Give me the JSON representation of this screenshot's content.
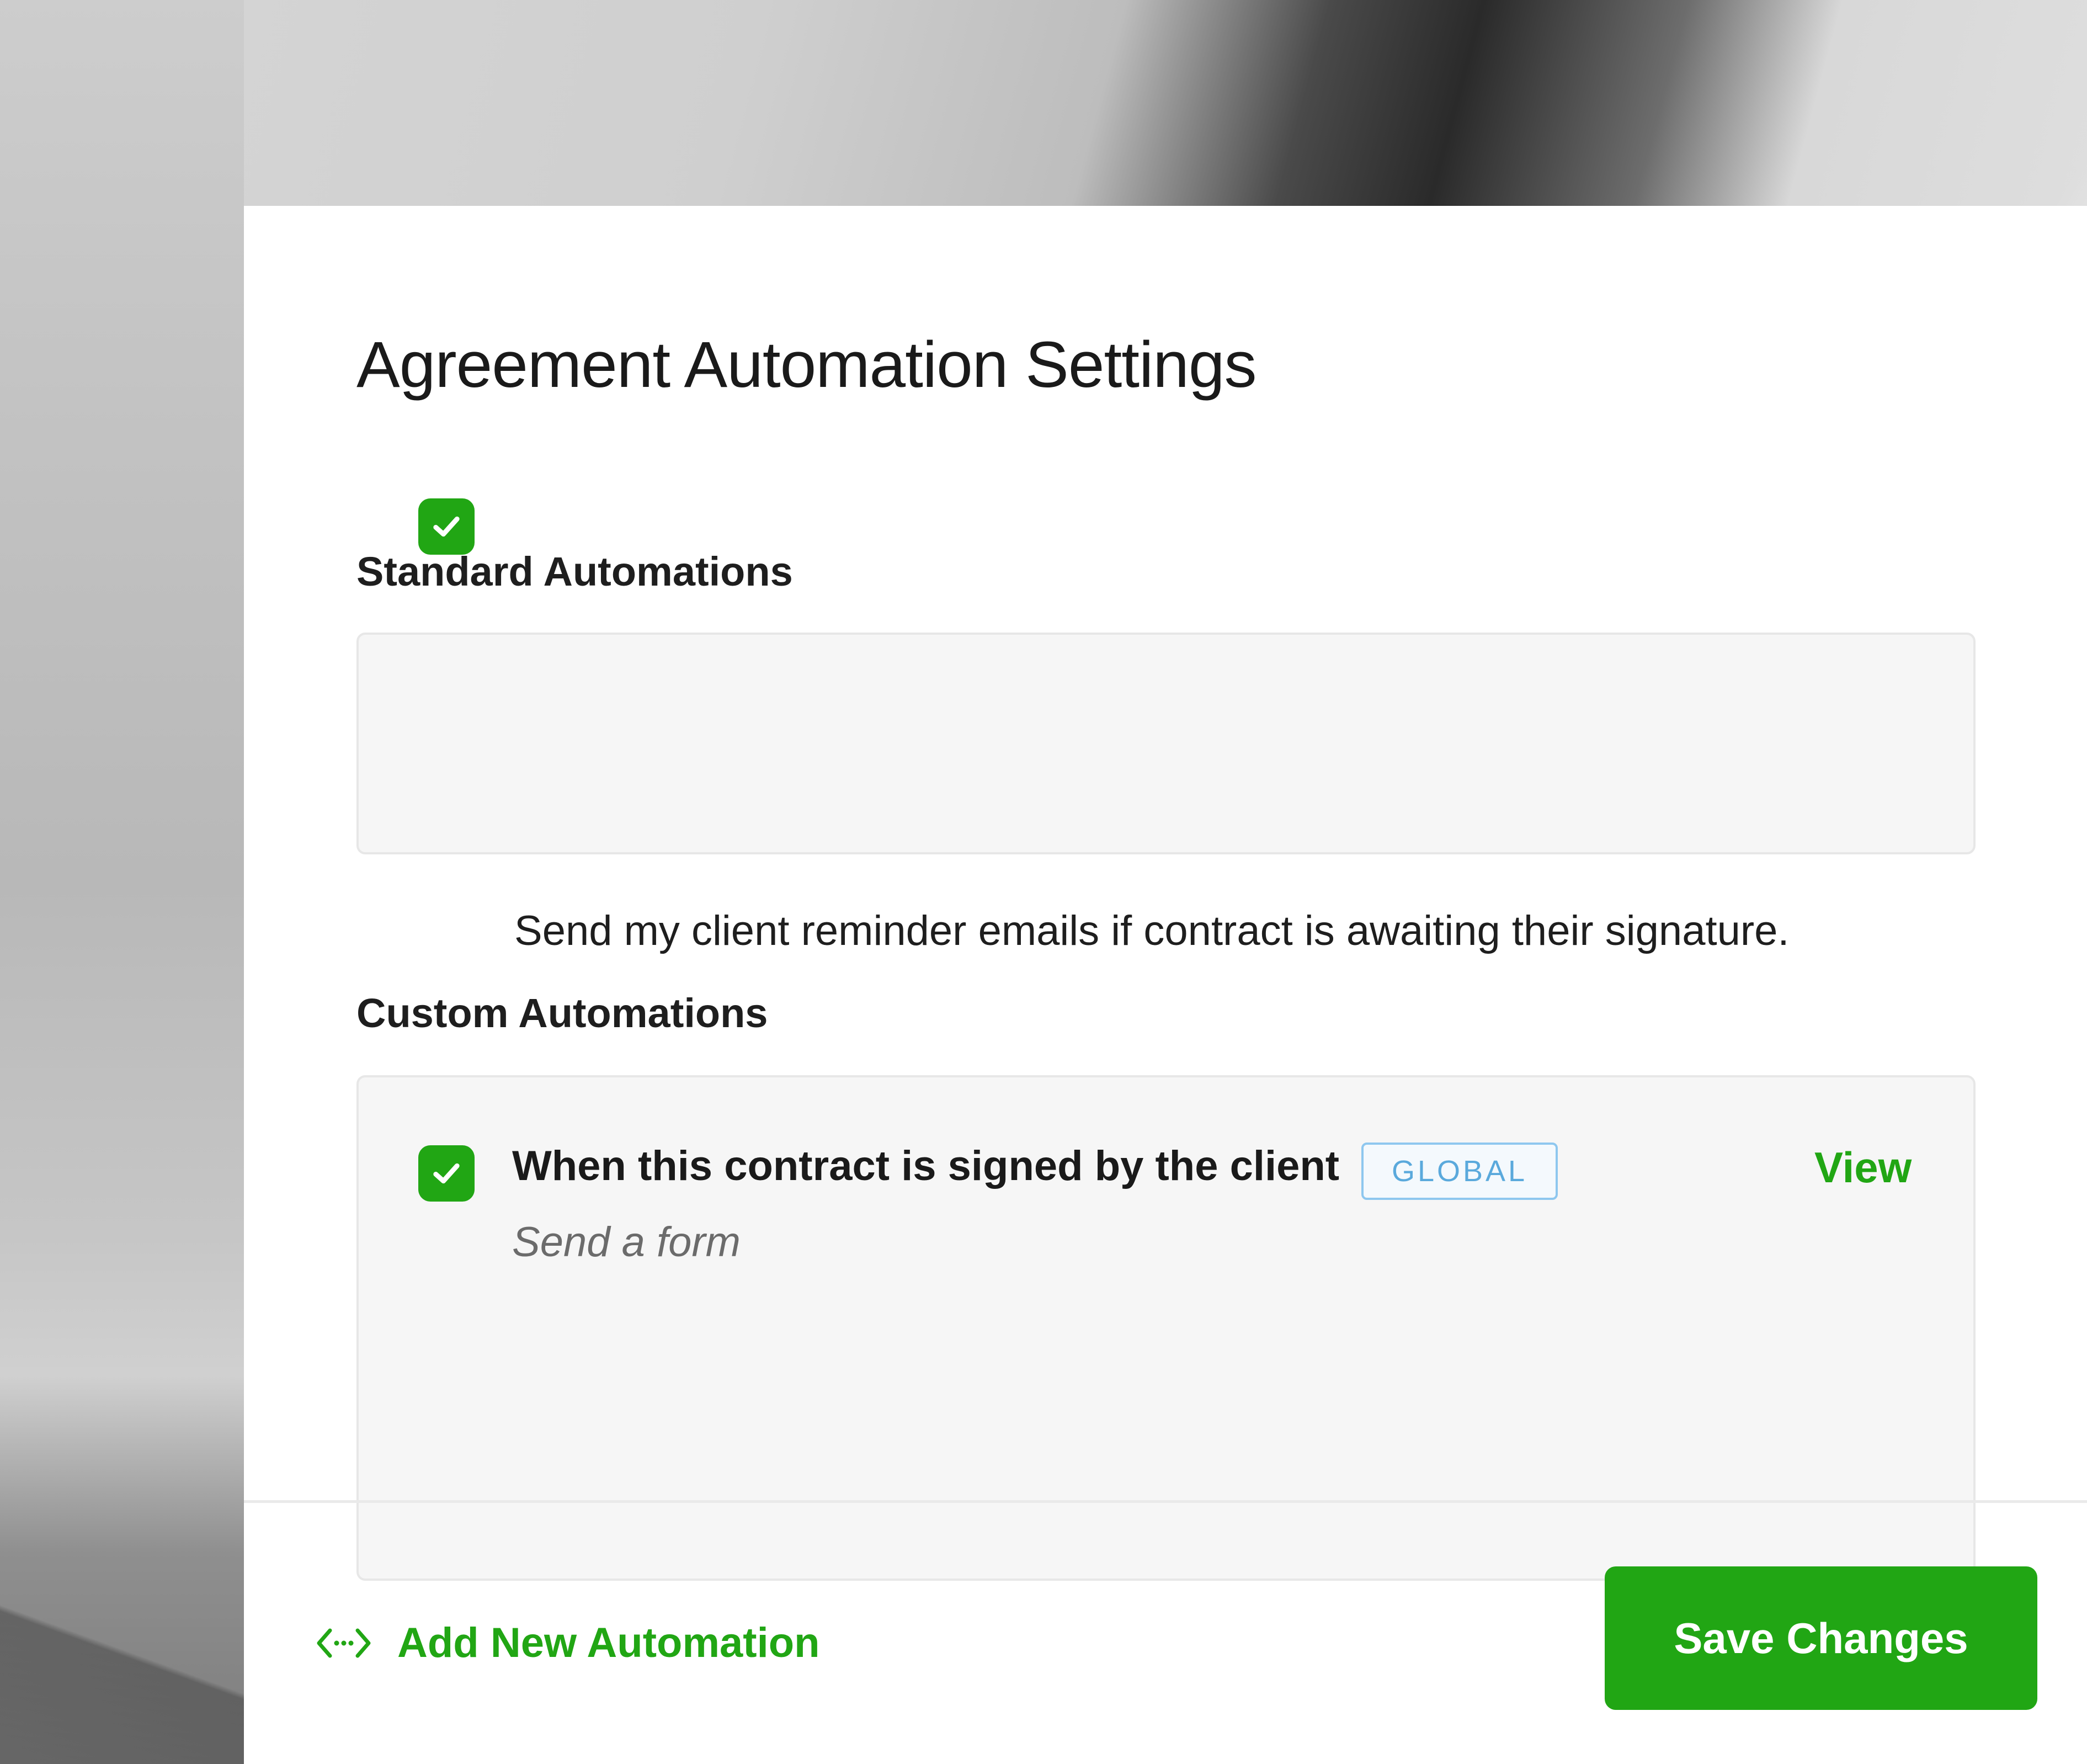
{
  "page_title": "Agreement Automation Settings",
  "standard": {
    "heading": "Standard Automations",
    "items": [
      {
        "checked": true,
        "label": "Send my client reminder emails if contract is awaiting their signature."
      }
    ]
  },
  "custom": {
    "heading": "Custom Automations",
    "items": [
      {
        "checked": true,
        "title": "When this contract is signed by the client",
        "badge": "GLOBAL",
        "action": "Send a form",
        "view_label": "View"
      }
    ]
  },
  "footer": {
    "add_label": "Add New Automation",
    "save_label": "Save Changes"
  },
  "colors": {
    "accent": "#21a614",
    "badge": "#5aa9dc"
  },
  "icons": {
    "checkbox": "check-icon",
    "add": "automation-icon"
  }
}
